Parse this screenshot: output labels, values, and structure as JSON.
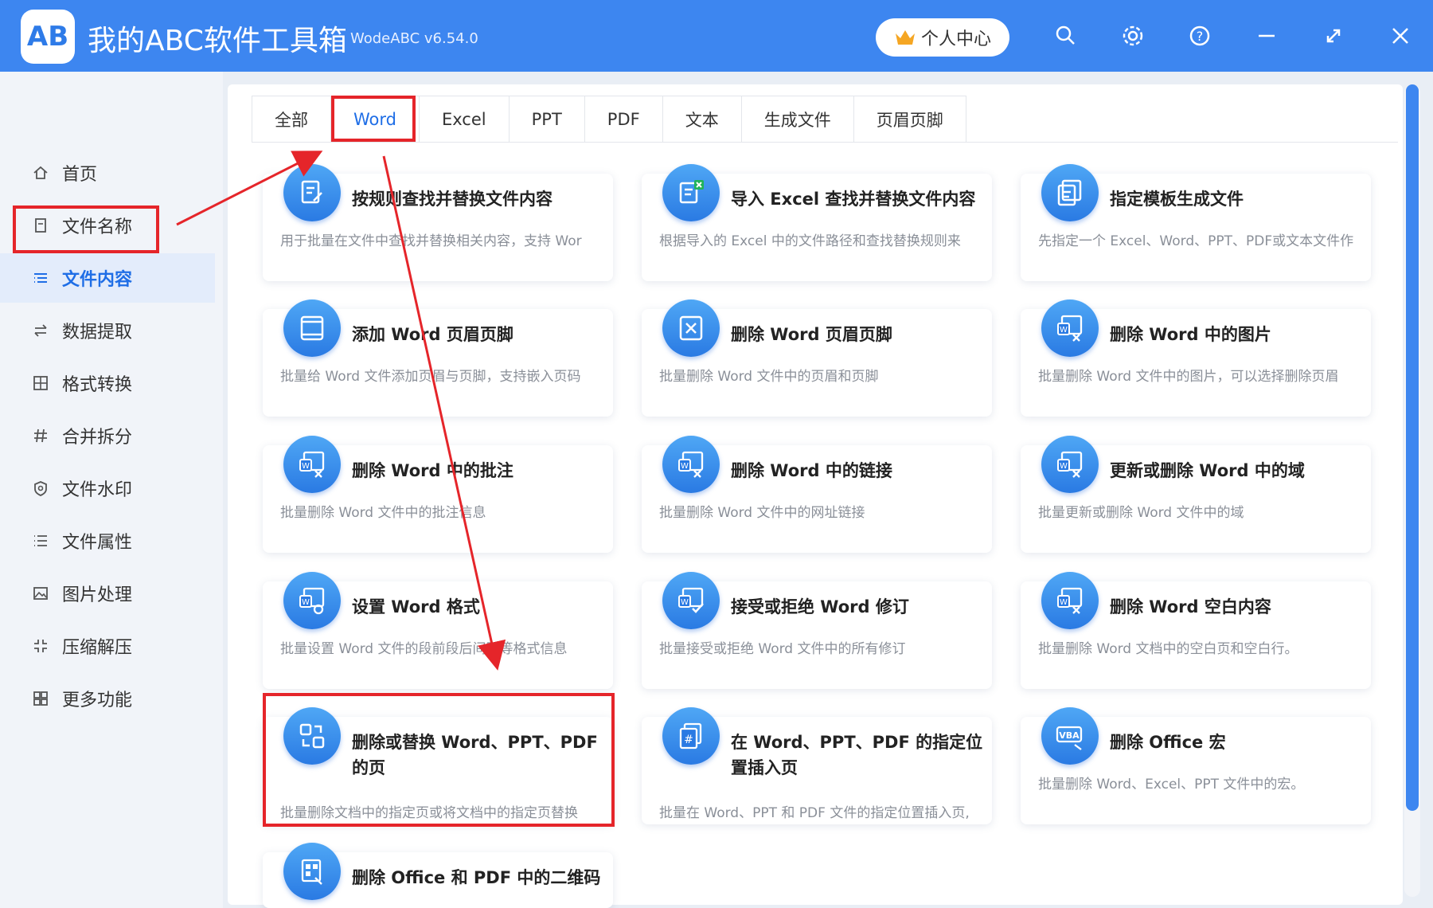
{
  "app": {
    "title": "我的ABC软件工具箱",
    "version": "WodeABC v6.54.0",
    "user_center": "个人中心",
    "logo_text": "AB"
  },
  "sidebar": {
    "items": [
      {
        "label": "首页",
        "icon": "home-icon"
      },
      {
        "label": "文件名称",
        "icon": "file-name-icon"
      },
      {
        "label": "文件内容",
        "icon": "file-content-icon",
        "active": true
      },
      {
        "label": "数据提取",
        "icon": "data-extract-icon"
      },
      {
        "label": "格式转换",
        "icon": "format-convert-icon"
      },
      {
        "label": "合并拆分",
        "icon": "merge-split-icon"
      },
      {
        "label": "文件水印",
        "icon": "watermark-icon"
      },
      {
        "label": "文件属性",
        "icon": "file-attr-icon"
      },
      {
        "label": "图片处理",
        "icon": "image-icon"
      },
      {
        "label": "压缩解压",
        "icon": "compress-icon"
      },
      {
        "label": "更多功能",
        "icon": "more-icon"
      }
    ]
  },
  "tabs": [
    {
      "label": "全部"
    },
    {
      "label": "Word",
      "active": true
    },
    {
      "label": "Excel"
    },
    {
      "label": "PPT"
    },
    {
      "label": "PDF"
    },
    {
      "label": "文本"
    },
    {
      "label": "生成文件"
    },
    {
      "label": "页眉页脚"
    }
  ],
  "cards": [
    {
      "title": "按规则查找并替换文件内容",
      "desc": "用于批量在文件中查找并替换相关内容，支持 Wor",
      "icon": "doc-edit-icon"
    },
    {
      "title": "导入 Excel 查找并替换文件内容",
      "desc": "根据导入的 Excel 中的文件路径和查找替换规则来",
      "icon": "excel-doc-icon"
    },
    {
      "title": "指定模板生成文件",
      "desc": "先指定一个 Excel、Word、PPT、PDF或文本文件作",
      "icon": "template-icon"
    },
    {
      "title": "添加 Word 页眉页脚",
      "desc": "批量给 Word 文件添加页眉与页脚，支持嵌入页码",
      "icon": "header-footer-icon"
    },
    {
      "title": "删除 Word 页眉页脚",
      "desc": "批量删除 Word 文件中的页眉和页脚",
      "icon": "delete-header-icon"
    },
    {
      "title": "删除 Word 中的图片",
      "desc": "批量删除 Word 文件中的图片，可以选择删除页眉",
      "icon": "word-image-delete-icon"
    },
    {
      "title": "删除 Word 中的批注",
      "desc": "批量删除 Word 文件中的批注信息",
      "icon": "word-comment-delete-icon"
    },
    {
      "title": "删除 Word 中的链接",
      "desc": "批量删除 Word 文件中的网址链接",
      "icon": "word-link-delete-icon"
    },
    {
      "title": "更新或删除 Word 中的域",
      "desc": "批量更新或删除 Word 文件中的域",
      "icon": "word-field-icon"
    },
    {
      "title": "设置 Word 格式",
      "desc": "批量设置 Word 文件的段前段后间距等格式信息",
      "icon": "word-format-icon"
    },
    {
      "title": "接受或拒绝 Word 修订",
      "desc": "批量接受或拒绝 Word 文件中的所有修订",
      "icon": "word-revision-icon"
    },
    {
      "title": "删除 Word 空白内容",
      "desc": "批量删除 Word 文档中的空白页和空白行。",
      "icon": "word-blank-delete-icon"
    },
    {
      "title": "删除或替换 Word、PPT、PDF 的页",
      "desc": "批量删除文档中的指定页或将文档中的指定页替换",
      "icon": "page-replace-icon"
    },
    {
      "title": "在 Word、PPT、PDF 的指定位置插入页",
      "desc": "批量在 Word、PPT 和 PDF 文件的指定位置插入页,",
      "icon": "page-insert-icon"
    },
    {
      "title": "删除 Office 宏",
      "desc": "批量删除 Word、Excel、PPT 文件中的宏。",
      "icon": "vba-icon"
    },
    {
      "title": "删除 Office 和 PDF 中的二维码",
      "desc": "",
      "icon": "qrcode-icon"
    }
  ],
  "colors": {
    "accent": "#3d86f0",
    "highlight": "#e5252a",
    "active_text": "#1f6ee6"
  }
}
